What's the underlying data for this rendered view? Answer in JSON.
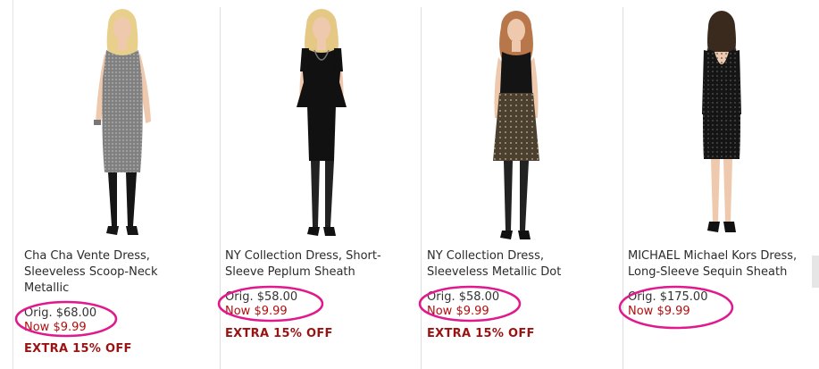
{
  "products": [
    {
      "name_lines": [
        "Cha Cha Vente Dress,",
        "Sleeveless Scoop-Neck",
        "Metallic"
      ],
      "orig_price": "Orig. $68.00",
      "now_price": "Now $9.99",
      "promo": "EXTRA 15% OFF",
      "dress_color": "#808080",
      "hair_color": "#e8d08c"
    },
    {
      "name_lines": [
        "NY Collection Dress, Short-",
        "Sleeve Peplum Sheath"
      ],
      "orig_price": "Orig. $58.00",
      "now_price": "Now $9.99",
      "promo": "EXTRA 15% OFF",
      "dress_color": "#111111",
      "hair_color": "#e4c884"
    },
    {
      "name_lines": [
        "NY Collection Dress,",
        "Sleeveless Metallic Dot"
      ],
      "orig_price": "Orig. $58.00",
      "now_price": "Now $9.99",
      "promo": "EXTRA 15% OFF",
      "dress_color": "#141414",
      "skirt_color": "#4a4032",
      "hair_color": "#b8774a"
    },
    {
      "name_lines": [
        "MICHAEL Michael Kors Dress,",
        "Long-Sleeve Sequin Sheath"
      ],
      "orig_price": "Orig. $175.00",
      "now_price": "Now $9.99",
      "dress_color": "#151515",
      "hair_color": "#3a2a1e"
    }
  ],
  "colors": {
    "annotation_circle": "#e0198c",
    "now_price": "#b01010",
    "promo": "#9a1212"
  }
}
